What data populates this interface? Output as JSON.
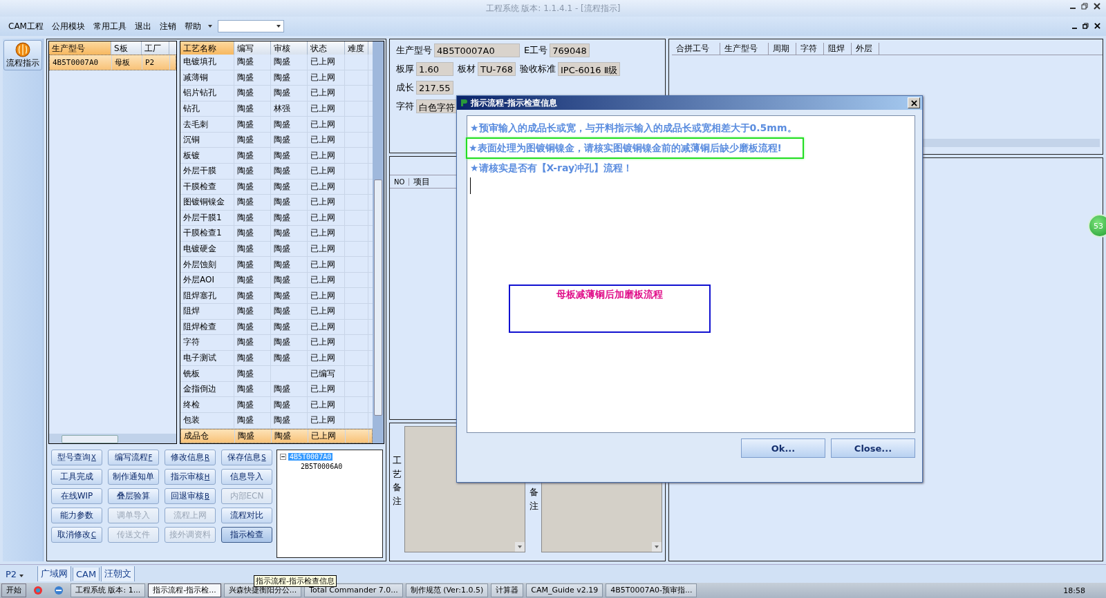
{
  "window": {
    "title": "工程系统  版本: 1.1.4.1 - [流程指示]"
  },
  "menu": [
    "CAM工程",
    "公用模块",
    "常用工具",
    "退出",
    "注销",
    "帮助"
  ],
  "nav": [
    {
      "label": "流程指示",
      "selected": true
    }
  ],
  "model_table": {
    "columns": [
      "生产型号",
      "S板",
      "工厂"
    ],
    "rows": [
      {
        "cells": [
          "4B5T0007A0",
          "母板",
          "P2"
        ],
        "selected": true
      }
    ]
  },
  "process_table": {
    "columns": [
      "工艺名称",
      "编写",
      "审核",
      "状态",
      "难度"
    ],
    "rows": [
      {
        "name": "电镀填孔",
        "writer": "陶盛",
        "reviewer": "陶盛",
        "status": "已上网",
        "selected": false
      },
      {
        "name": "减薄铜",
        "writer": "陶盛",
        "reviewer": "陶盛",
        "status": "已上网",
        "selected": false
      },
      {
        "name": "铝片钻孔",
        "writer": "陶盛",
        "reviewer": "陶盛",
        "status": "已上网",
        "selected": false
      },
      {
        "name": "钻孔",
        "writer": "陶盛",
        "reviewer": "林强",
        "status": "已上网",
        "selected": false
      },
      {
        "name": "去毛刺",
        "writer": "陶盛",
        "reviewer": "陶盛",
        "status": "已上网",
        "selected": false
      },
      {
        "name": "沉铜",
        "writer": "陶盛",
        "reviewer": "陶盛",
        "status": "已上网",
        "selected": false
      },
      {
        "name": "板镀",
        "writer": "陶盛",
        "reviewer": "陶盛",
        "status": "已上网",
        "selected": false
      },
      {
        "name": "外层干膜",
        "writer": "陶盛",
        "reviewer": "陶盛",
        "status": "已上网",
        "selected": false
      },
      {
        "name": "干膜检查",
        "writer": "陶盛",
        "reviewer": "陶盛",
        "status": "已上网",
        "selected": false
      },
      {
        "name": "图镀铜镍金",
        "writer": "陶盛",
        "reviewer": "陶盛",
        "status": "已上网",
        "selected": false
      },
      {
        "name": "外层干膜1",
        "writer": "陶盛",
        "reviewer": "陶盛",
        "status": "已上网",
        "selected": false
      },
      {
        "name": "干膜检查1",
        "writer": "陶盛",
        "reviewer": "陶盛",
        "status": "已上网",
        "selected": false
      },
      {
        "name": "电镀硬金",
        "writer": "陶盛",
        "reviewer": "陶盛",
        "status": "已上网",
        "selected": false
      },
      {
        "name": "外层蚀刻",
        "writer": "陶盛",
        "reviewer": "陶盛",
        "status": "已上网",
        "selected": false
      },
      {
        "name": "外层AOI",
        "writer": "陶盛",
        "reviewer": "陶盛",
        "status": "已上网",
        "selected": false
      },
      {
        "name": "阻焊塞孔",
        "writer": "陶盛",
        "reviewer": "陶盛",
        "status": "已上网",
        "selected": false
      },
      {
        "name": "阻焊",
        "writer": "陶盛",
        "reviewer": "陶盛",
        "status": "已上网",
        "selected": false
      },
      {
        "name": "阻焊检查",
        "writer": "陶盛",
        "reviewer": "陶盛",
        "status": "已上网",
        "selected": false
      },
      {
        "name": "字符",
        "writer": "陶盛",
        "reviewer": "陶盛",
        "status": "已上网",
        "selected": false
      },
      {
        "name": "电子测试",
        "writer": "陶盛",
        "reviewer": "陶盛",
        "status": "已上网",
        "selected": false
      },
      {
        "name": "铣板",
        "writer": "陶盛",
        "status": "已编写",
        "selected": false
      },
      {
        "name": "金指倒边",
        "writer": "陶盛",
        "reviewer": "陶盛",
        "status": "已上网",
        "selected": false
      },
      {
        "name": "终检",
        "writer": "陶盛",
        "reviewer": "陶盛",
        "status": "已上网",
        "selected": false
      },
      {
        "name": "包装",
        "writer": "陶盛",
        "reviewer": "陶盛",
        "status": "已上网",
        "selected": false
      },
      {
        "name": "成品仓",
        "writer": "陶盛",
        "reviewer": "陶盛",
        "status": "已上网",
        "selected": true
      }
    ]
  },
  "buttons": [
    {
      "label": "型号查询",
      "key": "X",
      "disabled": false,
      "pressed": false
    },
    {
      "label": "编写流程",
      "key": "F",
      "disabled": false,
      "pressed": false
    },
    {
      "label": "修改信息",
      "key": "R",
      "disabled": false,
      "pressed": false
    },
    {
      "label": "保存信息",
      "key": "S",
      "disabled": false,
      "pressed": false
    },
    {
      "label": "工具完成",
      "disabled": false,
      "pressed": false
    },
    {
      "label": "制作通知单",
      "disabled": false,
      "pressed": false
    },
    {
      "label": "指示审核",
      "key": "H",
      "disabled": false,
      "pressed": false
    },
    {
      "label": "信息导入",
      "disabled": false,
      "pressed": false
    },
    {
      "label": "在线WIP",
      "disabled": false,
      "pressed": false
    },
    {
      "label": "叠层验算",
      "disabled": false,
      "pressed": false
    },
    {
      "label": "回退审核",
      "key": "B",
      "disabled": false,
      "pressed": false
    },
    {
      "label": "内部ECN",
      "disabled": true,
      "pressed": false
    },
    {
      "label": "能力参数",
      "disabled": false,
      "pressed": false
    },
    {
      "label": "调单导入",
      "disabled": true,
      "pressed": false
    },
    {
      "label": "流程上网",
      "disabled": true,
      "pressed": false
    },
    {
      "label": "流程对比",
      "disabled": false,
      "pressed": false
    },
    {
      "label": "取消修改",
      "key": "C",
      "disabled": false,
      "pressed": false
    },
    {
      "label": "传送文件",
      "disabled": true,
      "pressed": false
    },
    {
      "label": "接外调资料",
      "disabled": true,
      "pressed": false
    },
    {
      "label": "指示检查",
      "disabled": false,
      "pressed": true
    }
  ],
  "tree": [
    {
      "label": "4B5T0007A0",
      "selected": true,
      "expanded": true,
      "children": [
        {
          "label": "2B5T0006A0",
          "selected": false
        }
      ]
    }
  ],
  "info": [
    [
      {
        "label": "生产型号",
        "value": "4B5T0007A0"
      },
      {
        "label": "E工号",
        "value": "769048"
      }
    ],
    [
      {
        "label": "板厚",
        "value": "1.60"
      },
      {
        "label": "板材",
        "value": "TU-768"
      },
      {
        "label": "验收标准",
        "value": "IPC-6016 Ⅱ级"
      }
    ],
    [
      {
        "label": "成长",
        "value": "217.55"
      }
    ],
    [
      {
        "label": "字符",
        "value": "白色字符"
      }
    ]
  ],
  "items_table": {
    "columns": [
      "NO",
      "项目"
    ]
  },
  "remarks": [
    "工艺备注",
    "备注"
  ],
  "merge_table": {
    "columns": [
      "合拼工号",
      "生产型号",
      "周期",
      "字符",
      "阻焊",
      "外层"
    ]
  },
  "badge": "53",
  "bottom_bar": {
    "selector": "P2",
    "tabs": [
      {
        "label": "广域网",
        "selected": false
      },
      {
        "label": "CAM",
        "selected": false
      },
      {
        "label": "汪朝文",
        "selected": false
      }
    ]
  },
  "tooltip": "指示流程-指示检查信息",
  "dialog": {
    "title": "指示流程-指示检查信息",
    "lines": [
      {
        "text": "★预审输入的成品长或宽，与开料指示输入的成品长或宽相差大于0.5mm。",
        "highlighted": false
      },
      {
        "text": "★表面处理为图镀铜镍金，请核实图镀铜镍金前的减薄铜后缺少磨板流程!",
        "highlighted": true
      },
      {
        "text": "★请核实是否有【X-ray冲孔】流程！",
        "highlighted": false
      }
    ],
    "note": "母板减薄铜后加磨板流程",
    "buttons": [
      "Ok...",
      "Close..."
    ]
  },
  "taskbar": {
    "start": "开始",
    "items": [
      {
        "label": "工程系统  版本: 1...",
        "selected": false
      },
      {
        "label": "指示流程-指示检...",
        "selected": true
      },
      {
        "label": "兴森快捷衡阳分公...",
        "selected": false
      },
      {
        "label": "Total Commander 7.0...",
        "selected": false
      },
      {
        "label": "制作规范 (Ver:1.0.5)",
        "selected": false
      },
      {
        "label": "计算器",
        "selected": false
      },
      {
        "label": "CAM_Guide v2.19",
        "selected": false
      },
      {
        "label": "4B5T0007A0-预审指...",
        "selected": false
      }
    ],
    "clock": "18:58"
  }
}
